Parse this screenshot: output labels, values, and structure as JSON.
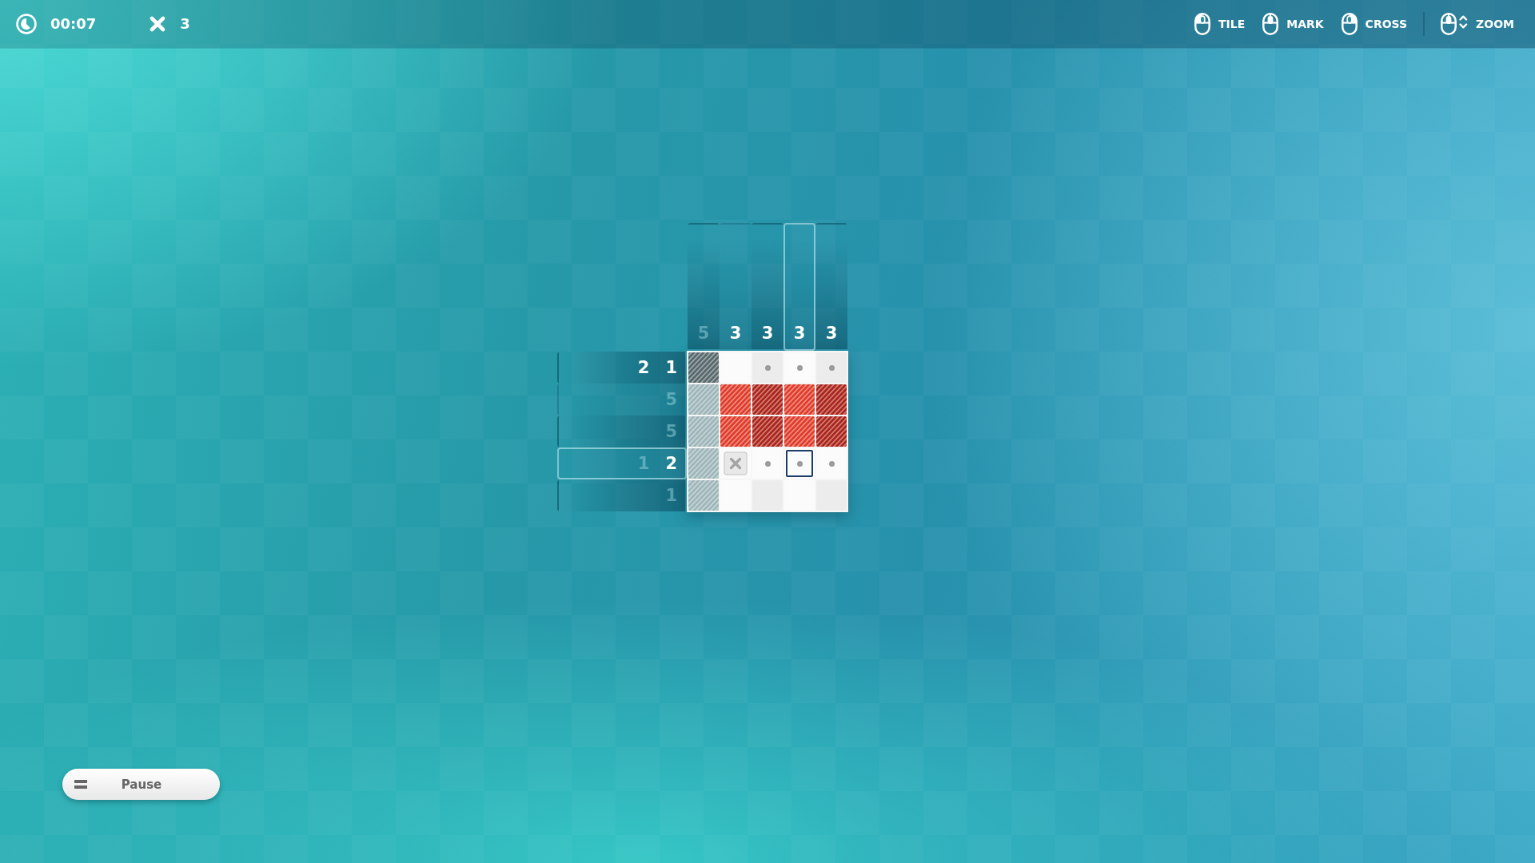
{
  "hud": {
    "timer": "00:07",
    "mistakes": "3"
  },
  "control_groups": [
    {
      "items": [
        {
          "kind": "left",
          "label": "TILE"
        },
        {
          "kind": "middle",
          "label": "MARK"
        },
        {
          "kind": "right",
          "label": "CROSS"
        }
      ]
    },
    {
      "items": [
        {
          "kind": "wheel",
          "label": "ZOOM"
        }
      ]
    }
  ],
  "puzzle": {
    "column_clues": [
      {
        "selected": false,
        "numbers": [
          {
            "text": "5",
            "done": true
          }
        ]
      },
      {
        "selected": false,
        "numbers": [
          {
            "text": "3",
            "done": false
          }
        ]
      },
      {
        "selected": false,
        "numbers": [
          {
            "text": "3",
            "done": false
          }
        ]
      },
      {
        "selected": true,
        "numbers": [
          {
            "text": "3",
            "done": false
          }
        ]
      },
      {
        "selected": false,
        "numbers": [
          {
            "text": "3",
            "done": false
          }
        ]
      }
    ],
    "rows": [
      {
        "selected": false,
        "clues": [
          {
            "text": "2",
            "done": false
          },
          {
            "text": "1",
            "done": false
          }
        ],
        "cells": [
          {
            "kind": "filled",
            "color": "#56676a",
            "selected": false
          },
          {
            "kind": "empty",
            "selected": false
          },
          {
            "kind": "dot",
            "selected": false
          },
          {
            "kind": "dot",
            "selected": false
          },
          {
            "kind": "dot",
            "selected": false
          }
        ]
      },
      {
        "selected": false,
        "clues": [
          {
            "text": "5",
            "done": true
          }
        ],
        "cells": [
          {
            "kind": "filled",
            "color": "#9db5b9",
            "selected": false
          },
          {
            "kind": "filled",
            "color": "#e03a28",
            "selected": false
          },
          {
            "kind": "filled",
            "color": "#ab2218",
            "selected": false
          },
          {
            "kind": "filled",
            "color": "#e03a28",
            "selected": false
          },
          {
            "kind": "filled",
            "color": "#ab2218",
            "selected": false
          }
        ]
      },
      {
        "selected": false,
        "clues": [
          {
            "text": "5",
            "done": true
          }
        ],
        "cells": [
          {
            "kind": "filled",
            "color": "#9db5b9",
            "selected": false
          },
          {
            "kind": "filled",
            "color": "#e03a28",
            "selected": false
          },
          {
            "kind": "filled",
            "color": "#ab2218",
            "selected": false
          },
          {
            "kind": "filled",
            "color": "#e03a28",
            "selected": false
          },
          {
            "kind": "filled",
            "color": "#ab2218",
            "selected": false
          }
        ]
      },
      {
        "selected": true,
        "clues": [
          {
            "text": "1",
            "done": true
          },
          {
            "text": "2",
            "done": false
          }
        ],
        "cells": [
          {
            "kind": "filled",
            "color": "#9db5b9",
            "selected": false
          },
          {
            "kind": "cross",
            "selected": false
          },
          {
            "kind": "dot",
            "selected": false
          },
          {
            "kind": "dot",
            "selected": true
          },
          {
            "kind": "dot",
            "selected": false
          }
        ]
      },
      {
        "selected": false,
        "clues": [
          {
            "text": "1",
            "done": true
          }
        ],
        "cells": [
          {
            "kind": "filled",
            "color": "#9db5b9",
            "selected": false
          },
          {
            "kind": "empty",
            "selected": false
          },
          {
            "kind": "empty",
            "selected": false
          },
          {
            "kind": "empty",
            "selected": false
          },
          {
            "kind": "empty",
            "selected": false
          }
        ]
      }
    ]
  },
  "pause_button": {
    "label": "Pause"
  }
}
